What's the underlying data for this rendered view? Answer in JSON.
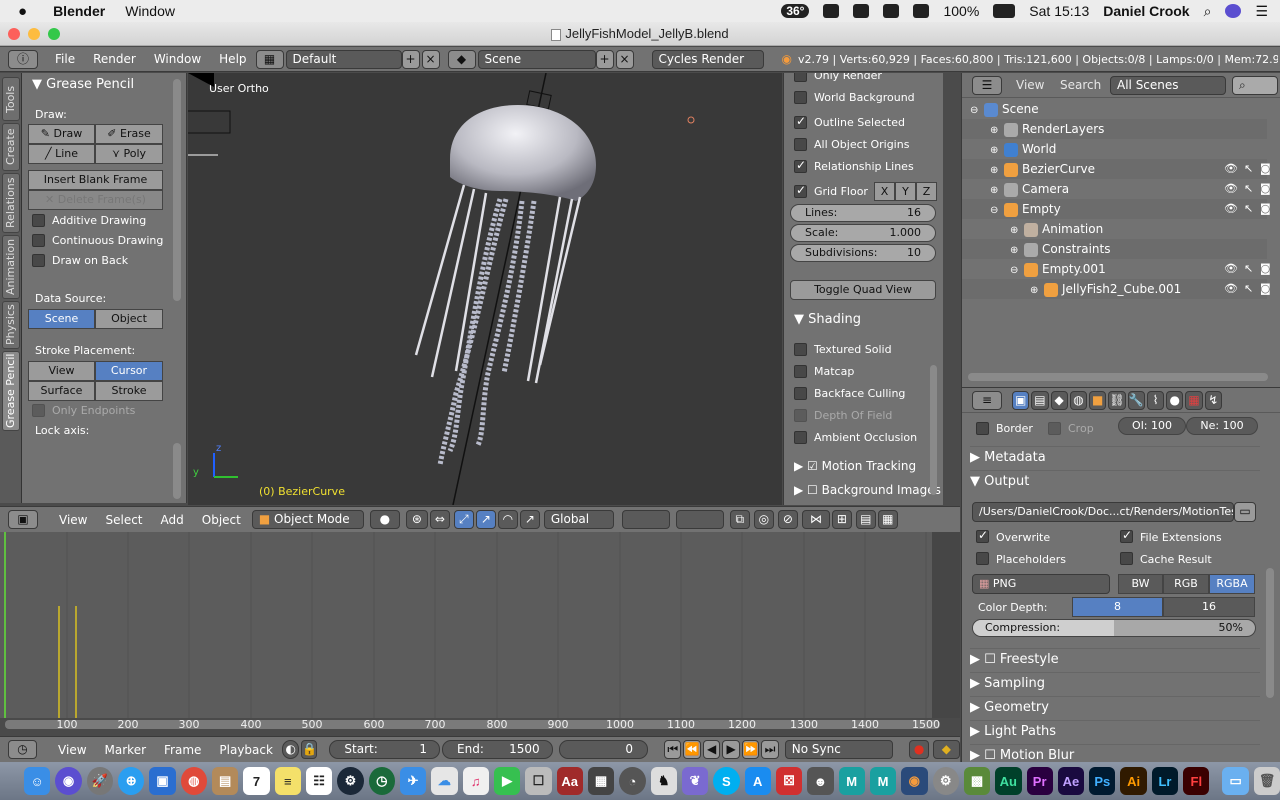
{
  "menubar": {
    "apple": "",
    "app": "Blender",
    "window": "Window",
    "temp": "36°",
    "battery": "100%",
    "clock": "Sat 15:13",
    "user": "Daniel Crook"
  },
  "titlebar": {
    "title": "JellyFishModel_JellyB.blend"
  },
  "infohdr": {
    "menus": [
      "File",
      "Render",
      "Window",
      "Help"
    ],
    "layout": "Default",
    "scene": "Scene",
    "engine": "Cycles Render",
    "stats": "v2.79 | Verts:60,929 | Faces:60,800 | Tris:121,600 | Objects:0/8 | Lamps:0/0 | Mem:72.95M | J"
  },
  "tabs": [
    "Tools",
    "Create",
    "Relations",
    "Animation",
    "Physics",
    "Grease Pencil"
  ],
  "toolshelf": {
    "panel": "Grease Pencil",
    "draw_label": "Draw:",
    "draw": "Draw",
    "erase": "Erase",
    "line": "Line",
    "poly": "Poly",
    "insert_blank": "Insert Blank Frame",
    "delete_frames": "Delete Frame(s)",
    "additive": "Additive Drawing",
    "continuous": "Continuous Drawing",
    "draw_on_back": "Draw on Back",
    "data_source": "Data Source:",
    "scene": "Scene",
    "object": "Object",
    "stroke_placement": "Stroke Placement:",
    "view": "View",
    "cursor": "Cursor",
    "surface": "Surface",
    "stroke": "Stroke",
    "only_endpoints": "Only Endpoints",
    "lock_axis": "Lock axis:"
  },
  "viewport": {
    "view_label": "User Ortho",
    "object_label": "(0) BezierCurve",
    "axis_z": "z",
    "axis_y": "y"
  },
  "npanel": {
    "only_render": "Only Render",
    "world_background": "World Background",
    "outline_selected": "Outline Selected",
    "all_object_origins": "All Object Origins",
    "relationship_lines": "Relationship Lines",
    "grid_floor": "Grid Floor",
    "x": "X",
    "y": "Y",
    "z": "Z",
    "lines_label": "Lines:",
    "lines_val": "16",
    "scale_label": "Scale:",
    "scale_val": "1.000",
    "subdiv_label": "Subdivisions:",
    "subdiv_val": "10",
    "toggle_quad": "Toggle Quad View",
    "shading": "Shading",
    "textured_solid": "Textured Solid",
    "matcap": "Matcap",
    "backface_culling": "Backface Culling",
    "depth_of_field": "Depth Of Field",
    "ambient_occlusion": "Ambient Occlusion",
    "motion_tracking": "Motion Tracking",
    "background_images": "Background Images"
  },
  "vhdr": {
    "view": "View",
    "select": "Select",
    "add": "Add",
    "object": "Object",
    "mode": "Object Mode",
    "orientation": "Global"
  },
  "timeline": {
    "ticks": [
      "100",
      "200",
      "300",
      "400",
      "500",
      "600",
      "700",
      "800",
      "900",
      "1000",
      "1100",
      "1200",
      "1300",
      "1400",
      "1500"
    ]
  },
  "tlhdr": {
    "view": "View",
    "marker": "Marker",
    "frame": "Frame",
    "playback": "Playback",
    "start_label": "Start:",
    "start_val": "1",
    "end_label": "End:",
    "end_val": "1500",
    "current": "0",
    "sync": "No Sync"
  },
  "outliner": {
    "view": "View",
    "search": "Search",
    "filter": "All Scenes",
    "rows": [
      {
        "label": "Scene"
      },
      {
        "label": "RenderLayers"
      },
      {
        "label": "World"
      },
      {
        "label": "BezierCurve"
      },
      {
        "label": "Camera"
      },
      {
        "label": "Empty"
      },
      {
        "label": "Animation"
      },
      {
        "label": "Constraints"
      },
      {
        "label": "Empty.001"
      },
      {
        "label": "JellyFish2_Cube.001"
      }
    ]
  },
  "props": {
    "border": "Border",
    "crop": "Crop",
    "ol": "Ol: 100",
    "ne": "Ne: 100",
    "metadata": "Metadata",
    "output": "Output",
    "path": "/Users/DanielCrook/Doc...ct/Renders/MotionTest2/",
    "overwrite": "Overwrite",
    "file_extensions": "File Extensions",
    "placeholders": "Placeholders",
    "cache_result": "Cache Result",
    "format": "PNG",
    "bw": "BW",
    "rgb": "RGB",
    "rgba": "RGBA",
    "color_depth": "Color Depth:",
    "depth8": "8",
    "depth16": "16",
    "compression_label": "Compression:",
    "compression": "50%",
    "freestyle": "Freestyle",
    "sampling": "Sampling",
    "geometry": "Geometry",
    "light_paths": "Light Paths",
    "motion_blur": "Motion Blur"
  },
  "dock": {
    "ps": "Ps",
    "ai": "Ai",
    "lr": "Lr",
    "fl": "Fl",
    "au": "Au",
    "pr": "Pr",
    "ae": "Ae",
    "cal": "7"
  }
}
